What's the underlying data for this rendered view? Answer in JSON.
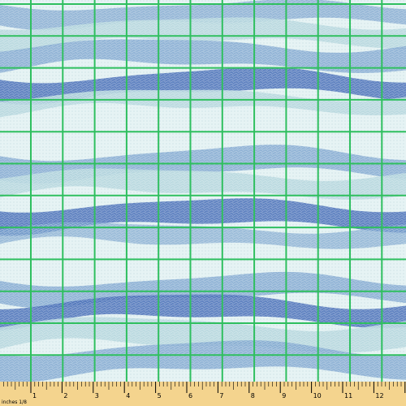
{
  "fabric": {
    "pattern": "horizontal wavy stripes with scribble texture",
    "colors": {
      "background": "#e6f3f4",
      "light_wave": "#b8d8df",
      "mid_wave": "#7fa6cf",
      "dark_wave": "#4b71b8",
      "grid": "#2fbf5f"
    }
  },
  "ruler": {
    "caption": "inches 1/8",
    "ticks": [
      "1",
      "2",
      "3",
      "4",
      "5",
      "6",
      "7",
      "8",
      "9",
      "10",
      "11",
      "12",
      "1"
    ],
    "colors": {
      "background": "#f4d48e",
      "tick": "#000000"
    }
  }
}
